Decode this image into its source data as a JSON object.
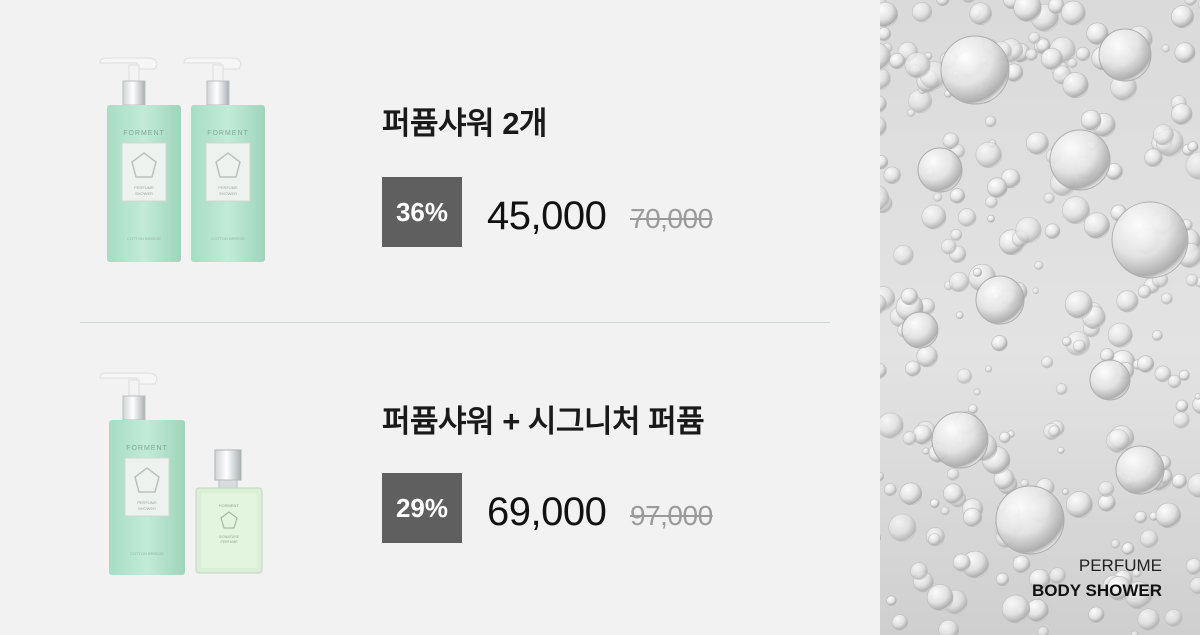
{
  "offers": [
    {
      "title": "퍼퓸샤워 2개",
      "discount": "36%",
      "price": "45,000",
      "original_price": "70,000",
      "products": [
        {
          "type": "pump-bottle",
          "brand": "FORMENT",
          "label": "PERFUME SHOWER",
          "note": "COTTON BREEZE"
        },
        {
          "type": "pump-bottle",
          "brand": "FORMENT",
          "label": "PERFUME SHOWER",
          "note": "COTTON BREEZE"
        }
      ]
    },
    {
      "title": "퍼퓸샤워 + 시그니처 퍼퓸",
      "discount": "29%",
      "price": "69,000",
      "original_price": "97,000",
      "products": [
        {
          "type": "pump-bottle",
          "brand": "FORMENT",
          "label": "PERFUME SHOWER",
          "note": "COTTON BREEZE"
        },
        {
          "type": "perfume-bottle",
          "brand": "FORMENT",
          "label": "SIGNATURE PERFUME"
        }
      ]
    }
  ],
  "side_panel": {
    "line1": "PERFUME",
    "line2": "BODY SHOWER",
    "image": "soap-bubbles-foam"
  },
  "colors": {
    "background": "#f2f2f2",
    "badge": "#5f5f5f",
    "bottle": "#b6e3cf",
    "divider": "#cdd8d4"
  }
}
